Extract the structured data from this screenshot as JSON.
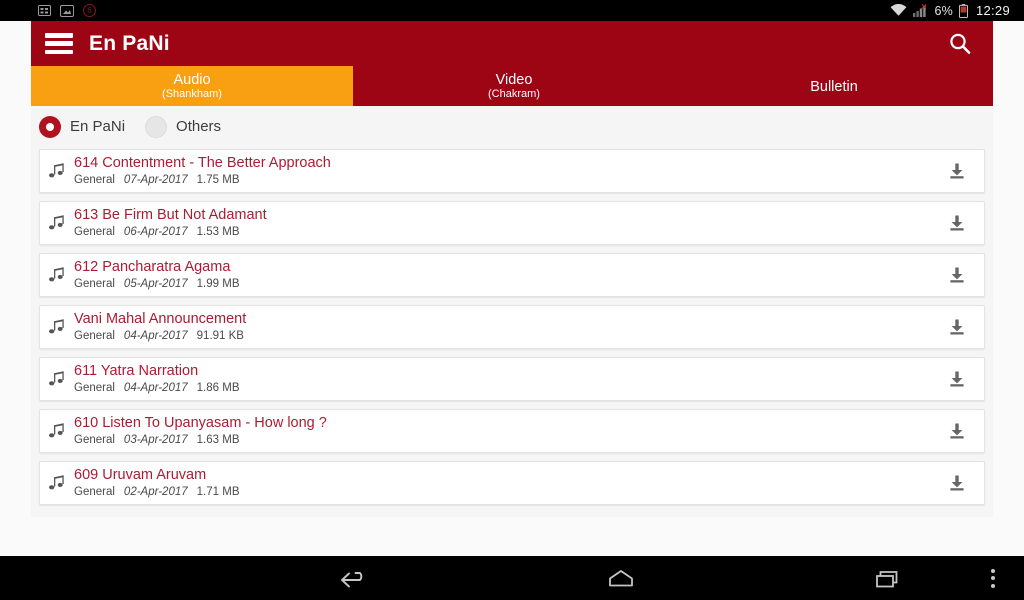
{
  "status_bar": {
    "left_icons": [
      "sim-card-icon",
      "sd-card-icon"
    ],
    "notification_badge": "6",
    "wifi_icon": "wifi-icon",
    "signal_icon": "cellular-signal-off-icon",
    "battery_text": "6%",
    "battery_icon": "battery-icon",
    "time": "12:29"
  },
  "action_bar": {
    "menu_icon": "hamburger-menu-icon",
    "title": "En PaNi",
    "search_icon": "search-icon",
    "background_color": "#9d0515"
  },
  "tabs": {
    "active_index": 0,
    "active_color": "#f99f12",
    "items": [
      {
        "label": "Audio",
        "sub": "(Shankham)"
      },
      {
        "label": "Video",
        "sub": "(Chakram)"
      },
      {
        "label": "Bulletin",
        "sub": ""
      }
    ]
  },
  "filter": {
    "selected": "En PaNi",
    "options": [
      {
        "label": "En PaNi",
        "selected": true
      },
      {
        "label": "Others",
        "selected": false
      }
    ]
  },
  "list": {
    "item_icon": "music-note-icon",
    "download_icon": "download-icon",
    "items": [
      {
        "title": "614 Contentment - The Better Approach",
        "category": "General",
        "date": "07-Apr-2017",
        "size": "1.75 MB"
      },
      {
        "title": "613 Be Firm But Not Adamant",
        "category": "General",
        "date": "06-Apr-2017",
        "size": "1.53 MB"
      },
      {
        "title": "612 Pancharatra Agama",
        "category": "General",
        "date": "05-Apr-2017",
        "size": "1.99 MB"
      },
      {
        "title": "Vani Mahal Announcement",
        "category": "General",
        "date": "04-Apr-2017",
        "size": "91.91 KB"
      },
      {
        "title": "611 Yatra Narration",
        "category": "General",
        "date": "04-Apr-2017",
        "size": "1.86 MB"
      },
      {
        "title": "610 Listen To Upanyasam - How long ?",
        "category": "General",
        "date": "03-Apr-2017",
        "size": "1.63 MB"
      },
      {
        "title": "609 Uruvam Aruvam",
        "category": "General",
        "date": "02-Apr-2017",
        "size": "1.71 MB"
      }
    ]
  },
  "nav_bar": {
    "back_icon": "back-arrow-icon",
    "home_icon": "home-icon",
    "recents_icon": "recent-apps-icon",
    "overflow_icon": "overflow-menu-icon"
  }
}
